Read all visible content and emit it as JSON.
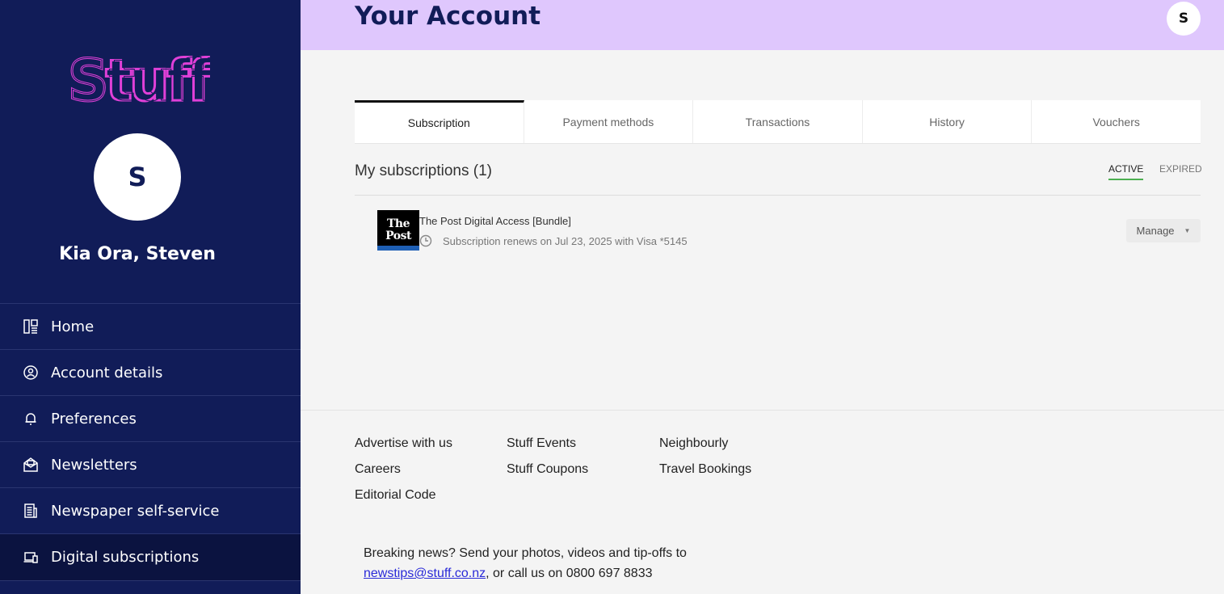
{
  "sidebar": {
    "logo_text": "Stuff",
    "avatar_initial": "S",
    "greeting": "Kia Ora, Steven",
    "items": [
      {
        "label": "Home",
        "icon": "home-layout-icon"
      },
      {
        "label": "Account details",
        "icon": "user-circle-icon"
      },
      {
        "label": "Preferences",
        "icon": "bell-icon"
      },
      {
        "label": "Newsletters",
        "icon": "mail-open-icon"
      },
      {
        "label": "Newspaper self-service",
        "icon": "newspaper-icon"
      },
      {
        "label": "Digital subscriptions",
        "icon": "devices-icon",
        "active": true
      }
    ]
  },
  "header": {
    "title": "Your Account",
    "avatar_initial": "S",
    "background": "#dfc7fd"
  },
  "tabs": [
    {
      "label": "Subscription",
      "active": true
    },
    {
      "label": "Payment methods"
    },
    {
      "label": "Transactions"
    },
    {
      "label": "History"
    },
    {
      "label": "Vouchers"
    }
  ],
  "subscriptions": {
    "heading": "My subscriptions (1)",
    "filters": {
      "active": "ACTIVE",
      "expired": "EXPIRED"
    },
    "items": [
      {
        "publication_logo": "The Post",
        "name": "The Post Digital Access [Bundle]",
        "detail": "Subscription renews on Jul 23, 2025 with Visa *5145",
        "manage_label": "Manage"
      }
    ]
  },
  "footer": {
    "links_col1": [
      "Advertise with us",
      "Careers",
      "Editorial Code"
    ],
    "links_col2": [
      "Stuff Events",
      "Stuff Coupons"
    ],
    "links_col3": [
      "Neighbourly",
      "Travel Bookings"
    ],
    "breaking_prefix": "Breaking news? Send your photos, videos and tip-offs to",
    "breaking_email": "newstips@stuff.co.nz",
    "breaking_suffix": ", or call us on 0800 697 8833"
  },
  "colors": {
    "sidebar_bg": "#111c58",
    "logo_pink": "#e040d8",
    "accent_green": "#4caf50",
    "link_blue": "#2a2ad8"
  }
}
